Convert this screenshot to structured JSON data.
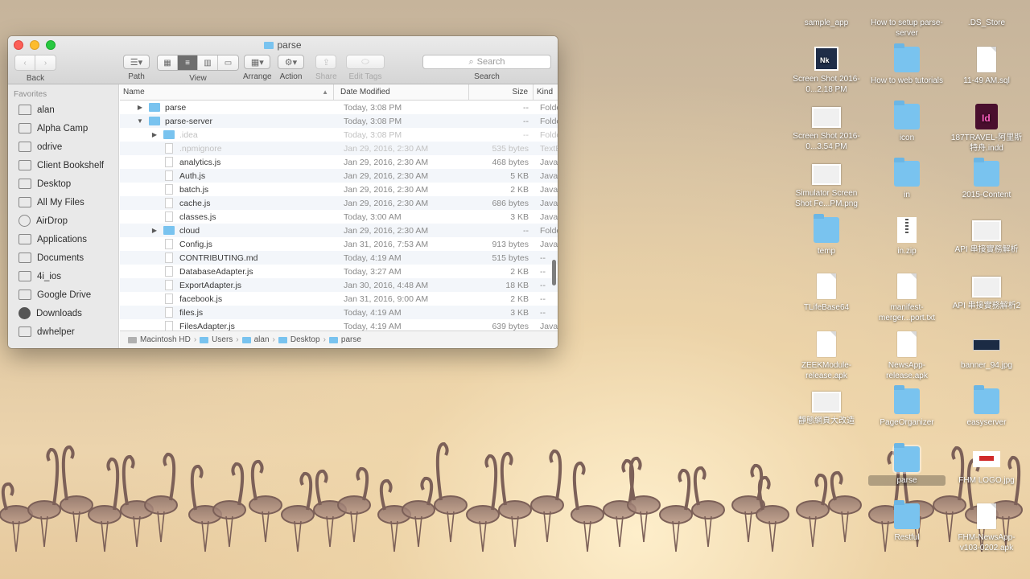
{
  "finder": {
    "title": "parse",
    "toolbar": {
      "back_label": "Back",
      "path_label": "Path",
      "view_label": "View",
      "arrange_label": "Arrange",
      "action_label": "Action",
      "share_label": "Share",
      "edit_tags_label": "Edit Tags",
      "search_label": "Search",
      "search_placeholder": "Search"
    },
    "sidebar": {
      "heading": "Favorites",
      "items": [
        {
          "label": "alan",
          "icon": "home-icon"
        },
        {
          "label": "Alpha Camp",
          "icon": "folder-icon"
        },
        {
          "label": "odrive",
          "icon": "folder-icon"
        },
        {
          "label": "Client Bookshelf",
          "icon": "folder-icon"
        },
        {
          "label": "Desktop",
          "icon": "folder-icon"
        },
        {
          "label": "All My Files",
          "icon": "all-files-icon"
        },
        {
          "label": "AirDrop",
          "icon": "airdrop-icon"
        },
        {
          "label": "Applications",
          "icon": "applications-icon"
        },
        {
          "label": "Documents",
          "icon": "folder-icon"
        },
        {
          "label": "4i_ios",
          "icon": "folder-icon"
        },
        {
          "label": "Google Drive",
          "icon": "folder-icon"
        },
        {
          "label": "Downloads",
          "icon": "downloads-icon"
        },
        {
          "label": "dwhelper",
          "icon": "folder-icon"
        }
      ]
    },
    "columns": {
      "name": "Name",
      "date": "Date Modified",
      "size": "Size",
      "kind": "Kind"
    },
    "rows": [
      {
        "name": "parse",
        "date": "Today, 3:08 PM",
        "size": "--",
        "kind": "Folder",
        "type": "folder",
        "indent": 0,
        "disclosure": "▶"
      },
      {
        "name": "parse-server",
        "date": "Today, 3:08 PM",
        "size": "--",
        "kind": "Folder",
        "type": "folder",
        "indent": 0,
        "disclosure": "▼"
      },
      {
        "name": ".idea",
        "date": "Today, 3:08 PM",
        "size": "--",
        "kind": "Folder",
        "type": "folder",
        "indent": 1,
        "disclosure": "▶",
        "dim": true
      },
      {
        "name": ".npmignore",
        "date": "Jan 29, 2016, 2:30 AM",
        "size": "535 bytes",
        "kind": "TextEdit",
        "type": "file",
        "indent": 1,
        "dim": true
      },
      {
        "name": "analytics.js",
        "date": "Jan 29, 2016, 2:30 AM",
        "size": "468 bytes",
        "kind": "JavaScript",
        "type": "file",
        "indent": 1
      },
      {
        "name": "Auth.js",
        "date": "Jan 29, 2016, 2:30 AM",
        "size": "5 KB",
        "kind": "JavaScript",
        "type": "file",
        "indent": 1
      },
      {
        "name": "batch.js",
        "date": "Jan 29, 2016, 2:30 AM",
        "size": "2 KB",
        "kind": "JavaScript",
        "type": "file",
        "indent": 1
      },
      {
        "name": "cache.js",
        "date": "Jan 29, 2016, 2:30 AM",
        "size": "686 bytes",
        "kind": "JavaScript",
        "type": "file",
        "indent": 1
      },
      {
        "name": "classes.js",
        "date": "Today, 3:00 AM",
        "size": "3 KB",
        "kind": "JavaScript",
        "type": "file",
        "indent": 1
      },
      {
        "name": "cloud",
        "date": "Jan 29, 2016, 2:30 AM",
        "size": "--",
        "kind": "Folder",
        "type": "folder",
        "indent": 1,
        "disclosure": "▶"
      },
      {
        "name": "Config.js",
        "date": "Jan 31, 2016, 7:53 AM",
        "size": "913 bytes",
        "kind": "JavaScript",
        "type": "file",
        "indent": 1
      },
      {
        "name": "CONTRIBUTING.md",
        "date": "Today, 4:19 AM",
        "size": "515 bytes",
        "kind": "--",
        "type": "file",
        "indent": 1
      },
      {
        "name": "DatabaseAdapter.js",
        "date": "Today, 3:27 AM",
        "size": "2 KB",
        "kind": "--",
        "type": "file",
        "indent": 1
      },
      {
        "name": "ExportAdapter.js",
        "date": "Jan 30, 2016, 4:48 AM",
        "size": "18 KB",
        "kind": "--",
        "type": "file",
        "indent": 1
      },
      {
        "name": "facebook.js",
        "date": "Jan 31, 2016, 9:00 AM",
        "size": "2 KB",
        "kind": "--",
        "type": "file",
        "indent": 1
      },
      {
        "name": "files.js",
        "date": "Today, 4:19 AM",
        "size": "3 KB",
        "kind": "--",
        "type": "file",
        "indent": 1
      },
      {
        "name": "FilesAdapter.js",
        "date": "Today, 4:19 AM",
        "size": "639 bytes",
        "kind": "JavaScript",
        "type": "file",
        "indent": 1
      }
    ],
    "pathbar": [
      "Macintosh HD",
      "Users",
      "alan",
      "Desktop",
      "parse"
    ]
  },
  "desktop": {
    "icons": [
      {
        "label": "sample_app",
        "glyph": "folder",
        "col": 0,
        "row": 0
      },
      {
        "label": "How to setup parse-server",
        "glyph": "folder",
        "col": 1,
        "row": 0
      },
      {
        "label": ".DS_Store",
        "glyph": "doc",
        "col": 2,
        "row": 0
      },
      {
        "label": "Screen Shot 2016-0...2.18 PM",
        "glyph": "dark",
        "col": 0,
        "row": 1
      },
      {
        "label": "How to web tutorials",
        "glyph": "folder",
        "col": 1,
        "row": 1
      },
      {
        "label": "11-49 AM.sql",
        "glyph": "doc",
        "col": 2,
        "row": 1
      },
      {
        "label": "Screen Shot 2016-0...3.54 PM",
        "glyph": "shot",
        "col": 0,
        "row": 2
      },
      {
        "label": "icon",
        "glyph": "folder",
        "col": 1,
        "row": 2
      },
      {
        "label": "187TRAVEL-阿里斯特舟.indd",
        "glyph": "indd",
        "col": 2,
        "row": 2
      },
      {
        "label": "Simulator Screen Shot Fe...PM.png",
        "glyph": "shot",
        "col": 0,
        "row": 3
      },
      {
        "label": "in",
        "glyph": "folder",
        "col": 1,
        "row": 3
      },
      {
        "label": "2015-Content",
        "glyph": "folder",
        "col": 2,
        "row": 3
      },
      {
        "label": "temp",
        "glyph": "folder",
        "col": 0,
        "row": 4
      },
      {
        "label": "in.zip",
        "glyph": "zip",
        "col": 1,
        "row": 4
      },
      {
        "label": "API 串接實務解析",
        "glyph": "shot",
        "col": 2,
        "row": 4
      },
      {
        "label": "TLifeBase64",
        "glyph": "doc",
        "col": 0,
        "row": 5
      },
      {
        "label": "manifest-merger...port.txt",
        "glyph": "doc",
        "col": 1,
        "row": 5
      },
      {
        "label": "API 串接實務解析2",
        "glyph": "shot",
        "col": 2,
        "row": 5
      },
      {
        "label": "ZEEKModule-release.apk",
        "glyph": "doc",
        "col": 0,
        "row": 6
      },
      {
        "label": "NewsApp-release.apk",
        "glyph": "doc",
        "col": 1,
        "row": 6
      },
      {
        "label": "banner_94.jpg",
        "glyph": "banner",
        "col": 2,
        "row": 6
      },
      {
        "label": "靜態網頁大改造",
        "glyph": "shot",
        "col": 0,
        "row": 7
      },
      {
        "label": "PageOrganizer",
        "glyph": "folder",
        "col": 1,
        "row": 7
      },
      {
        "label": "easyserver",
        "glyph": "folder",
        "col": 2,
        "row": 7
      },
      {
        "label": "parse",
        "glyph": "folder",
        "col": 1,
        "row": 8,
        "selected": true
      },
      {
        "label": "FHM LOGO.jpg",
        "glyph": "logo",
        "col": 2,
        "row": 8
      },
      {
        "label": "Restful",
        "glyph": "folder",
        "col": 1,
        "row": 9
      },
      {
        "label": "FHM-NewsApp-v103-0202.apk",
        "glyph": "doc",
        "col": 2,
        "row": 9
      }
    ]
  },
  "colors": {
    "folder": "#79c3ef",
    "accent": "#3b8ff0"
  }
}
